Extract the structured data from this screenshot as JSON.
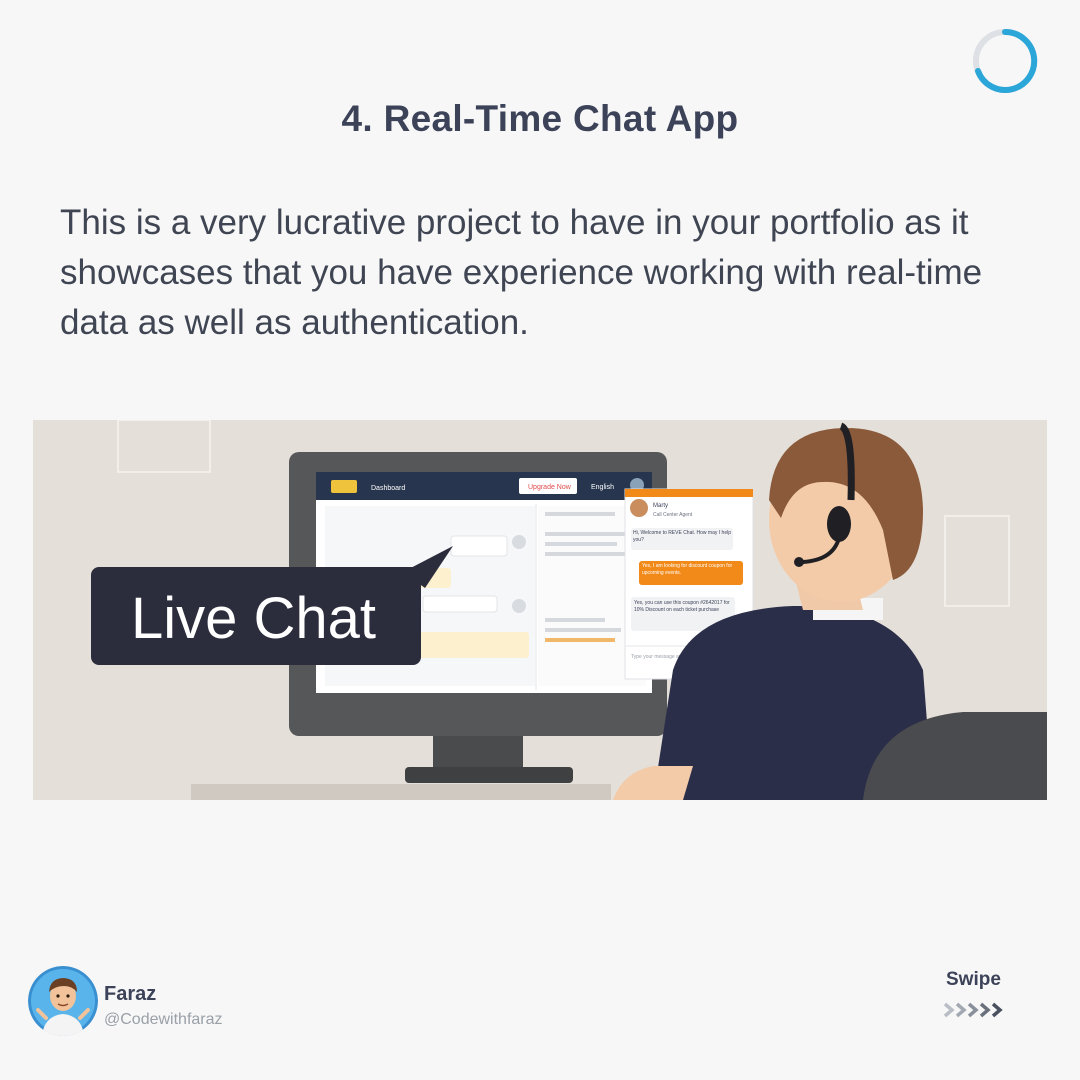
{
  "header": {
    "title": "4. Real-Time Chat App"
  },
  "description": "This is a very lucrative project to have in your portfolio as it showcases that you have experience working with real-time data as well as authentication.",
  "illustration": {
    "caption": "Live Chat",
    "dashboard": {
      "nav_item": "Dashboard",
      "upgrade_button": "Upgrade Now",
      "language": "English"
    },
    "chat_widget": {
      "agent_name": "Marty",
      "agent_role": "Call Center Agent",
      "messages": [
        {
          "from": "agent",
          "text": "Hi, Welcome to REVE Chat. How may I help you?"
        },
        {
          "from": "user",
          "text": "Yes, I am looking for discount coupon for upcoming events."
        },
        {
          "from": "agent",
          "text": "Yes, you can use this coupon #2642017 for 10% Discount on each ticket purchase"
        }
      ],
      "input_placeholder": "Type your message and press enter"
    }
  },
  "author": {
    "name": "Faraz",
    "handle": "@Codewithfaraz"
  },
  "swipe": {
    "label": "Swipe"
  },
  "colors": {
    "title": "#3c4358",
    "accent_orange": "#f28a1a",
    "ring_blue": "#2ba6d8",
    "bubble_dark": "#2b2d3c"
  }
}
